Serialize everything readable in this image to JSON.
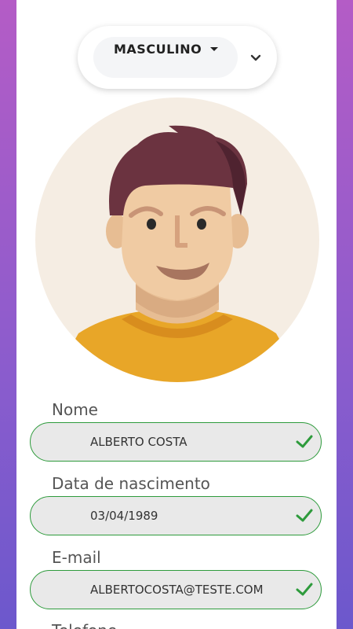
{
  "gender": {
    "selected": "MASCULINO",
    "caret_icon": "caret-down-icon",
    "chevron_icon": "chevron-down-icon"
  },
  "avatar": {
    "icon": "male-avatar-illustration"
  },
  "fields": [
    {
      "label": "Nome",
      "value": "ALBERTO COSTA",
      "status_icon": "check-icon"
    },
    {
      "label": "Data de nascimento",
      "value": "03/04/1989",
      "status_icon": "check-icon"
    },
    {
      "label": "E-mail",
      "value": "ALBERTOCOSTA@TESTE.COM",
      "status_icon": "check-icon"
    },
    {
      "label": "Telefone"
    }
  ],
  "colors": {
    "background_top": "#b45cc6",
    "background_bottom": "#6c58cc",
    "valid_border": "#2e9b3c",
    "check": "#2e9b3c",
    "field_bg": "#e9e9e9"
  }
}
